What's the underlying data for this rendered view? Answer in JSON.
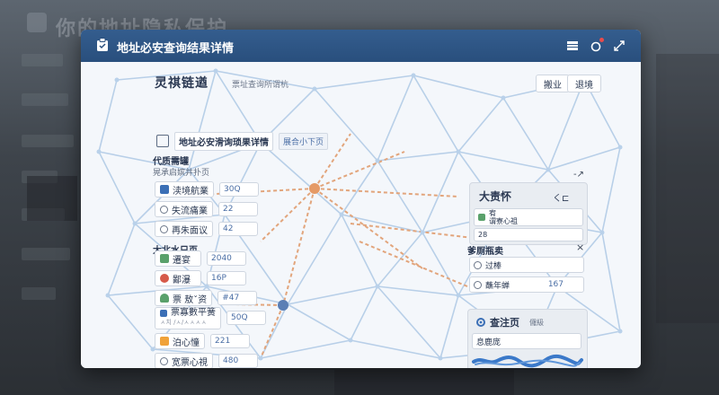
{
  "background": {
    "title": "你的地址隐私保护",
    "accent": "#2c5283"
  },
  "modal": {
    "title": "地址必安查询结果详情",
    "header_bg": "#2e5585",
    "header_buttons": [
      "grid-icon",
      "notification-icon",
      "expand-icon"
    ]
  },
  "main": {
    "subtitle": "灵祺链遒",
    "subtitle_note": "票址查询所谓杭",
    "top_buttons": [
      "搬业",
      "退境"
    ],
    "toolbar": {
      "label": "地址必安滑询琐果详情",
      "link": "展合小下页"
    }
  },
  "groups": [
    {
      "label": "代质需罐",
      "sublabel": "晃承启嫔并扑页",
      "items": [
        {
          "icon": "building-icon",
          "color": "#3b6fb6",
          "label": "渎境航業",
          "value": "30Q"
        },
        {
          "icon": "search-icon",
          "color": "#6b7689",
          "label": "失流痛業",
          "value": "22"
        },
        {
          "icon": "target-icon",
          "color": "#6b7689",
          "label": "再朱面议",
          "value": "42"
        }
      ]
    },
    {
      "label": "大北水只页",
      "sublabel": "",
      "items": [
        {
          "icon": "doc-icon",
          "color": "#5aa16b",
          "label": "遷宴",
          "value": "2040"
        },
        {
          "icon": "pie-icon",
          "color": "#d65a4a",
          "label": "鄙瀑",
          "value": "16P"
        },
        {
          "icon": "user-icon",
          "color": "#5aa16b",
          "label": "票 敖ˇ资",
          "value": "#47"
        },
        {
          "icon": "stack-icon",
          "color": "#3b6fb6",
          "label": "票寡數平簧",
          "note": "ㅅ치 /ㅅ/ㅅㅅㅅㅅ",
          "value": "50Q"
        },
        {
          "icon": "box-icon",
          "color": "#f0a23a",
          "label": "泊心憧",
          "value": "221"
        },
        {
          "icon": "link-icon",
          "color": "#6b7689",
          "label": "宽票心視",
          "value": "480"
        }
      ]
    }
  ],
  "graph": {
    "hub_color": "#e59a66",
    "node_color": "#5b7fb5",
    "edge_color": "#9fbfe0",
    "path_color": "#e2a57c",
    "corner_note": "-↗"
  },
  "right_panel_1": {
    "title": "大责怀",
    "title_glyph": "く⊏",
    "rows": [
      {
        "icon": "building-icon",
        "text": "宥\n谓寮心祖",
        "value": ""
      },
      {
        "icon": "",
        "text": "28",
        "value": ""
      }
    ]
  },
  "right_panel_2": {
    "title": "爹厕瓶卖",
    "close": "×",
    "rows": [
      {
        "icon": "target-icon",
        "text": "过棒",
        "value": ""
      },
      {
        "icon": "link-icon",
        "text": "蘸年蝉",
        "value": "167"
      }
    ]
  },
  "right_panel_3": {
    "title": "查注页",
    "title_note": "儸級",
    "field": "息鹿庞",
    "signature_color": "#3b79c9"
  }
}
